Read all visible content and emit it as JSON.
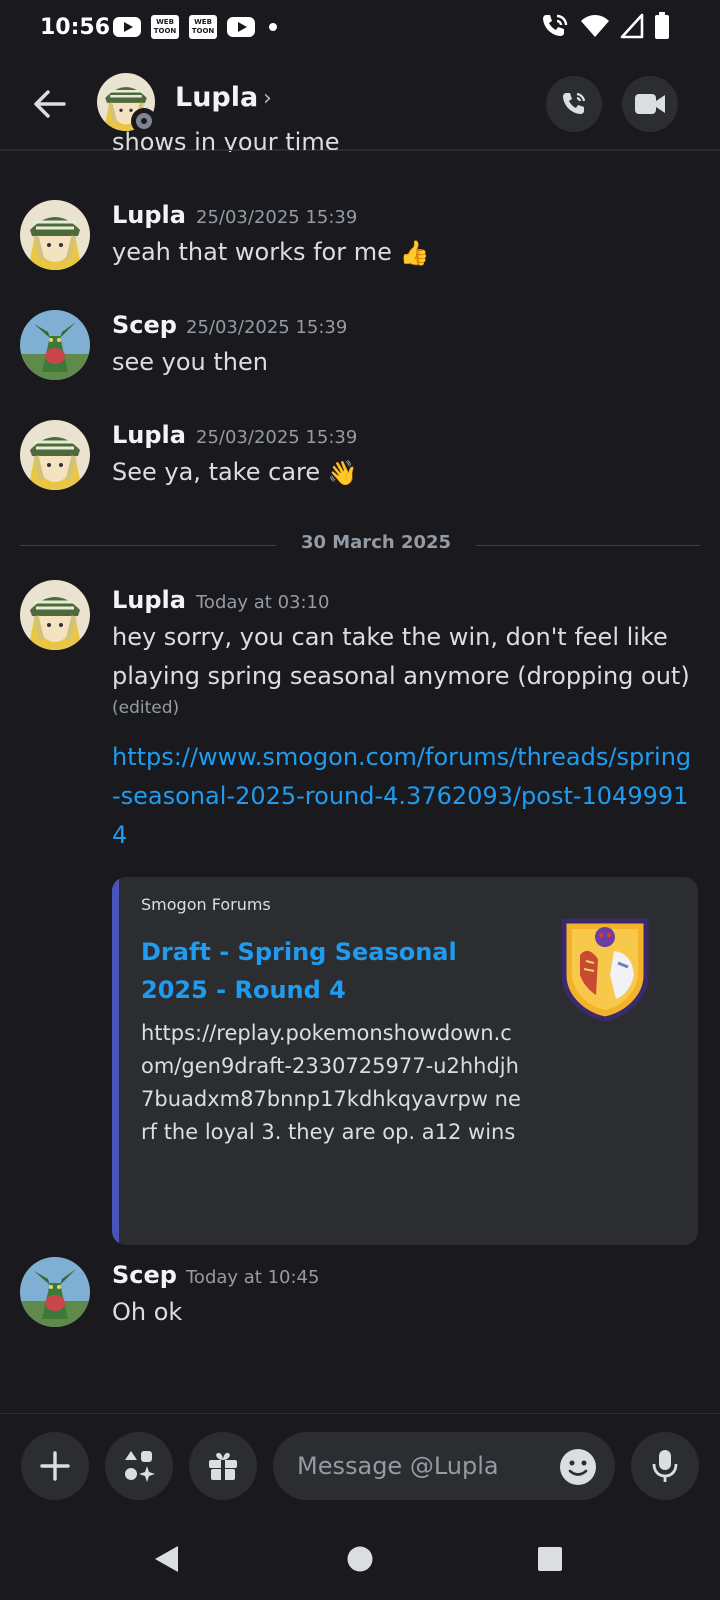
{
  "status_bar": {
    "time": "10:56",
    "app_icons": [
      "youtube-icon",
      "webtoon-icon",
      "webtoon-icon",
      "youtube-icon"
    ],
    "webtoon_label": "WEB TOON",
    "right_icons": [
      "wifi-calling-icon",
      "wifi-icon",
      "signal-icon",
      "battery-icon"
    ]
  },
  "header": {
    "name": "Lupla",
    "chevron": "›",
    "actions": [
      "voice-call-icon",
      "video-call-icon"
    ]
  },
  "clipped_text": "shows in your time",
  "messages": [
    {
      "author": "Lupla",
      "timestamp": "25/03/2025 15:39",
      "text": "yeah that works for me",
      "emoji": "👍"
    },
    {
      "author": "Scep",
      "timestamp": "25/03/2025 15:39",
      "text": "see you then"
    },
    {
      "author": "Lupla",
      "timestamp": "25/03/2025 15:39",
      "text": "See ya, take care",
      "emoji": "👋"
    }
  ],
  "date_divider": "30 March 2025",
  "today_message": {
    "author": "Lupla",
    "timestamp": "Today at 03:10",
    "text": "hey sorry, you can take the win, don't feel like playing spring seasonal anymore (dropping out)",
    "edited": "(edited)",
    "link": "https://www.smogon.com/forums/threads/spring-seasonal-2025-round-4.3762093/post-10499914",
    "embed": {
      "provider": "Smogon Forums",
      "title": "Draft - Spring Seasonal 2025 - Round 4",
      "description": "https://replay.pokemonshowdown.com/gen9draft-2330725977-u2hhdjh7buadxm87bnnp17kdhkqyavrpw nerf the loyal 3. they are op. a12 wins",
      "accent_color": "#5865f2"
    }
  },
  "last_message": {
    "author": "Scep",
    "timestamp": "Today at 10:45",
    "text": "Oh ok"
  },
  "composer": {
    "placeholder": "Message @Lupla",
    "buttons": [
      "plus-icon",
      "apps-icon",
      "gift-icon",
      "mic-icon"
    ]
  },
  "nav": [
    "back-triangle-icon",
    "home-circle-icon",
    "recents-square-icon"
  ],
  "colors": {
    "background": "#1a1a1e",
    "link": "#1f9cf0",
    "muted": "#949ba4",
    "surface": "#2b2d31"
  }
}
